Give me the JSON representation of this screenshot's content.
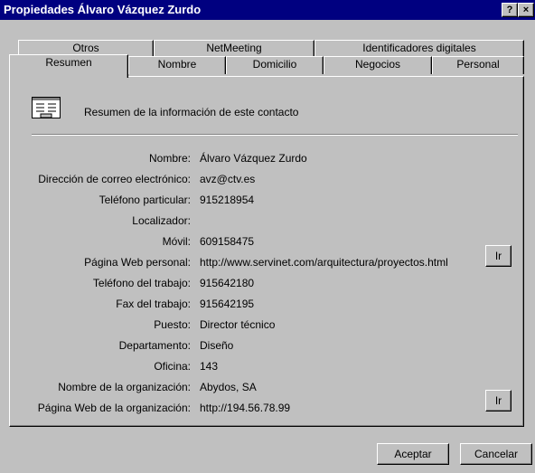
{
  "window": {
    "title": "Propiedades Álvaro Vázquez Zurdo",
    "help_button": "?",
    "close_button": "×"
  },
  "tabs": {
    "row1": [
      {
        "label": "Otros"
      },
      {
        "label": "NetMeeting"
      },
      {
        "label": "Identificadores digitales"
      }
    ],
    "row2": [
      {
        "label": "Resumen",
        "selected": true
      },
      {
        "label": "Nombre"
      },
      {
        "label": "Domicilio"
      },
      {
        "label": "Negocios"
      },
      {
        "label": "Personal"
      }
    ]
  },
  "summary": {
    "heading": "Resumen de la información de este contacto",
    "icon": "contact-card-icon"
  },
  "fields": [
    {
      "label": "Nombre:",
      "value": "Álvaro Vázquez Zurdo"
    },
    {
      "label": "Dirección de correo electrónico:",
      "value": "avz@ctv.es"
    },
    {
      "label": "Teléfono particular:",
      "value": "915218954"
    },
    {
      "label": "Localizador:",
      "value": ""
    },
    {
      "label": "Móvil:",
      "value": "609158475"
    },
    {
      "label": "Página Web personal:",
      "value": "http://www.servinet.com/arquitectura/proyectos.html"
    },
    {
      "label": "Teléfono del trabajo:",
      "value": "915642180"
    },
    {
      "label": "Fax del trabajo:",
      "value": "915642195"
    },
    {
      "label": "Puesto:",
      "value": "Director técnico"
    },
    {
      "label": "Departamento:",
      "value": "Diseño"
    },
    {
      "label": "Oficina:",
      "value": "143"
    },
    {
      "label": "Nombre de la organización:",
      "value": "Abydos, SA"
    },
    {
      "label": "Página Web de la organización:",
      "value": "http://194.56.78.99"
    }
  ],
  "buttons": {
    "go_personal": "Ir",
    "go_org": "Ir",
    "accept": "Aceptar",
    "cancel": "Cancelar"
  },
  "colors": {
    "titlebar": "#000080",
    "face": "#c0c0c0"
  }
}
